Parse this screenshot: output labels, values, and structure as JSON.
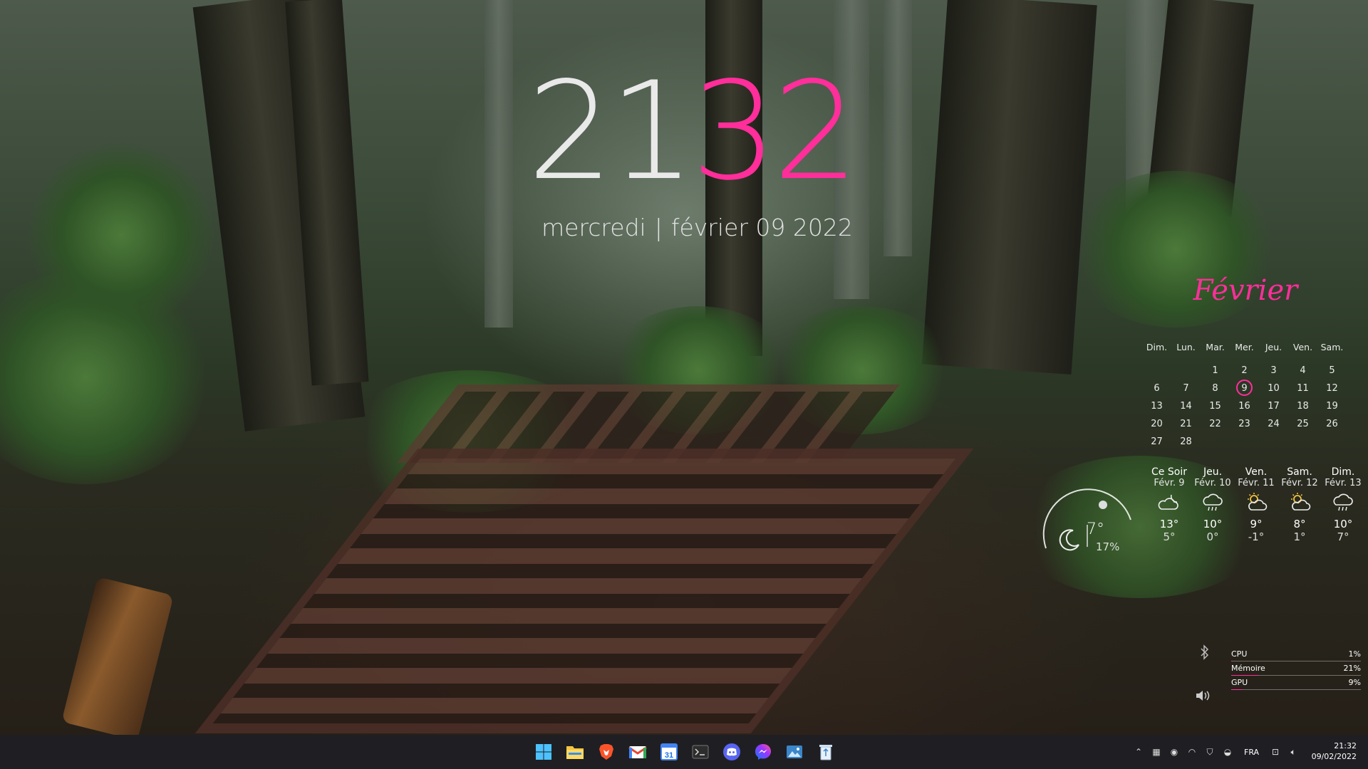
{
  "clock": {
    "hours": "21",
    "minutes": "32"
  },
  "date_line": {
    "weekday": "mercredi",
    "separator": "|",
    "date": "février 09 2022"
  },
  "calendar": {
    "month_title": "Février",
    "weekdays": [
      "Dim.",
      "Lun.",
      "Mar.",
      "Mer.",
      "Jeu.",
      "Ven.",
      "Sam."
    ],
    "weeks": [
      [
        "",
        "",
        "1",
        "2",
        "3",
        "4",
        "5"
      ],
      [
        "6",
        "7",
        "8",
        "9",
        "10",
        "11",
        "12"
      ],
      [
        "13",
        "14",
        "15",
        "16",
        "17",
        "18",
        "19"
      ],
      [
        "20",
        "21",
        "22",
        "23",
        "24",
        "25",
        "26"
      ],
      [
        "27",
        "28",
        "",
        "",
        "",
        "",
        ""
      ]
    ],
    "today": "9",
    "accent": "#ff2e9a"
  },
  "weather": {
    "current": {
      "temp": "7°",
      "humidity": "17%",
      "icon": "moon-icon"
    },
    "forecast": [
      {
        "day": "Ce Soir",
        "date": "Févr. 9",
        "hi": "13°",
        "lo": "5°",
        "icon": "cloudy-night-icon"
      },
      {
        "day": "Jeu.",
        "date": "Févr. 10",
        "hi": "10°",
        "lo": "0°",
        "icon": "rain-cloud-icon"
      },
      {
        "day": "Ven.",
        "date": "Févr. 11",
        "hi": "9°",
        "lo": "-1°",
        "icon": "partly-sunny-icon"
      },
      {
        "day": "Sam.",
        "date": "Févr. 12",
        "hi": "8°",
        "lo": "1°",
        "icon": "partly-sunny-icon"
      },
      {
        "day": "Dim.",
        "date": "Févr. 13",
        "hi": "10°",
        "lo": "7°",
        "icon": "rain-cloud-icon"
      }
    ]
  },
  "system_monitor": {
    "rows": [
      {
        "label": "CPU",
        "value": "1%",
        "fraction": 0.01
      },
      {
        "label": "Mémoire",
        "value": "21%",
        "fraction": 0.21
      },
      {
        "label": "GPU",
        "value": "9%",
        "fraction": 0.09
      }
    ]
  },
  "taskbar": {
    "apps": [
      "windows-start-icon",
      "file-explorer-icon",
      "brave-browser-icon",
      "gmail-icon",
      "google-calendar-icon",
      "terminal-icon",
      "discord-icon",
      "messenger-icon",
      "image-viewer-icon",
      "recycle-bin-icon"
    ],
    "calendar_icon_text": "31",
    "tray": {
      "language": "FRA"
    },
    "clock": {
      "time": "21:32",
      "date": "09/02/2022"
    }
  }
}
